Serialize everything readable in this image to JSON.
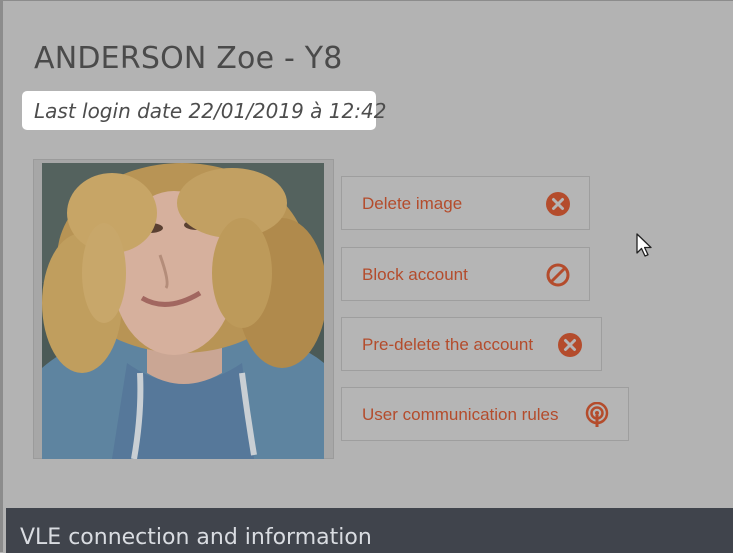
{
  "profile": {
    "name": "ANDERSON Zoe - Y8",
    "last_login": "Last login date 22/01/2019 à 12:42"
  },
  "actions": [
    {
      "label": "Delete image",
      "icon": "circle-x-icon"
    },
    {
      "label": "Block account",
      "icon": "ban-icon"
    },
    {
      "label": "Pre-delete the account",
      "icon": "circle-x-icon"
    },
    {
      "label": "User communication rules",
      "icon": "broadcast-icon"
    }
  ],
  "section": {
    "title": "VLE connection and information"
  },
  "colors": {
    "accent": "#b44c2c",
    "overlay": "#b3b3b3",
    "footer_bar": "#40444c"
  }
}
